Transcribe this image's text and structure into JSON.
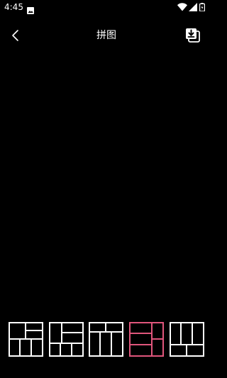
{
  "status_bar": {
    "time": "4:45",
    "icons": [
      "gallery-icon",
      "wifi-icon",
      "signal-icon",
      "battery-icon"
    ]
  },
  "toolbar": {
    "title": "拼图",
    "back_icon": "back-arrow-icon",
    "save_icon": "save-download-icon"
  },
  "colors": {
    "background": "#000000",
    "text": "#ffffff",
    "layout_default": "#ffffff",
    "layout_selected": "#e0567c"
  },
  "layouts": {
    "selected_index": 3,
    "items": [
      {
        "name": "layout-1"
      },
      {
        "name": "layout-2"
      },
      {
        "name": "layout-3"
      },
      {
        "name": "layout-4"
      },
      {
        "name": "layout-5"
      }
    ]
  }
}
